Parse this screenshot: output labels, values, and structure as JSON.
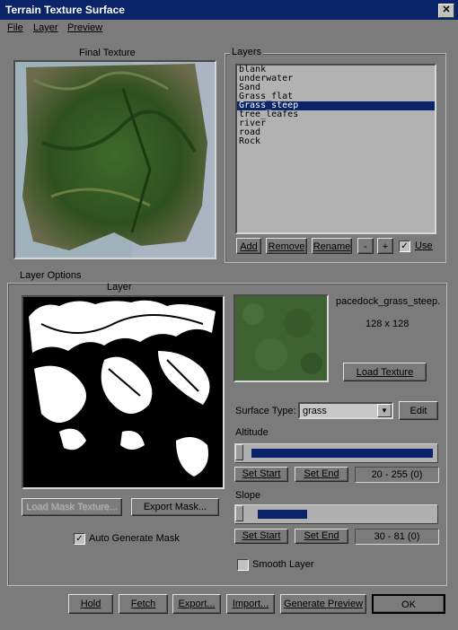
{
  "window": {
    "title": "Terrain Texture Surface",
    "close_glyph": "✕"
  },
  "menu": [
    "File",
    "Layer",
    "Preview"
  ],
  "final_texture": {
    "label": "Final Texture"
  },
  "layers": {
    "group_label": "Layers",
    "items": [
      "blank",
      "underwater",
      "Sand",
      "Grass_flat",
      "Grass_steep",
      "tree_leafes",
      "river",
      "road",
      "Rock"
    ],
    "selected_index": 4,
    "buttons": {
      "add": "Add",
      "remove": "Remove",
      "rename": "Rename",
      "minus": "-",
      "plus": "+"
    },
    "use_label": "Use",
    "use_checked": true
  },
  "layer_options": {
    "group_label": "Layer Options",
    "layer_label": "Layer",
    "texture_name": "pacedock_grass_steep.",
    "texture_size": "128 x 128",
    "load_texture": "Load Texture",
    "load_mask": "Load Mask Texture...",
    "export_mask": "Export Mask...",
    "auto_generate_label": "Auto Generate Mask",
    "auto_generate_checked": true,
    "surface_type_label": "Surface Type:",
    "surface_type_value": "grass",
    "edit": "Edit",
    "altitude": {
      "label": "Altitude",
      "set_start": "Set Start",
      "set_end": "Set End",
      "readout": "20 - 255 (0)",
      "range_start": 0.04,
      "range_end": 0.99
    },
    "slope": {
      "label": "Slope",
      "set_start": "Set Start",
      "set_end": "Set End",
      "readout": "30 - 81 (0)",
      "range_start": 0.07,
      "range_end": 0.33
    },
    "smooth_label": "Smooth Layer",
    "smooth_checked": false
  },
  "footer": {
    "hold": "Hold",
    "fetch": "Fetch",
    "export": "Export...",
    "import": "Import...",
    "generate": "Generate Preview",
    "ok": "OK"
  },
  "colors": {
    "titlebar": "#0a246a",
    "panel": "#7b7b7b",
    "selection": "#0a246a"
  }
}
